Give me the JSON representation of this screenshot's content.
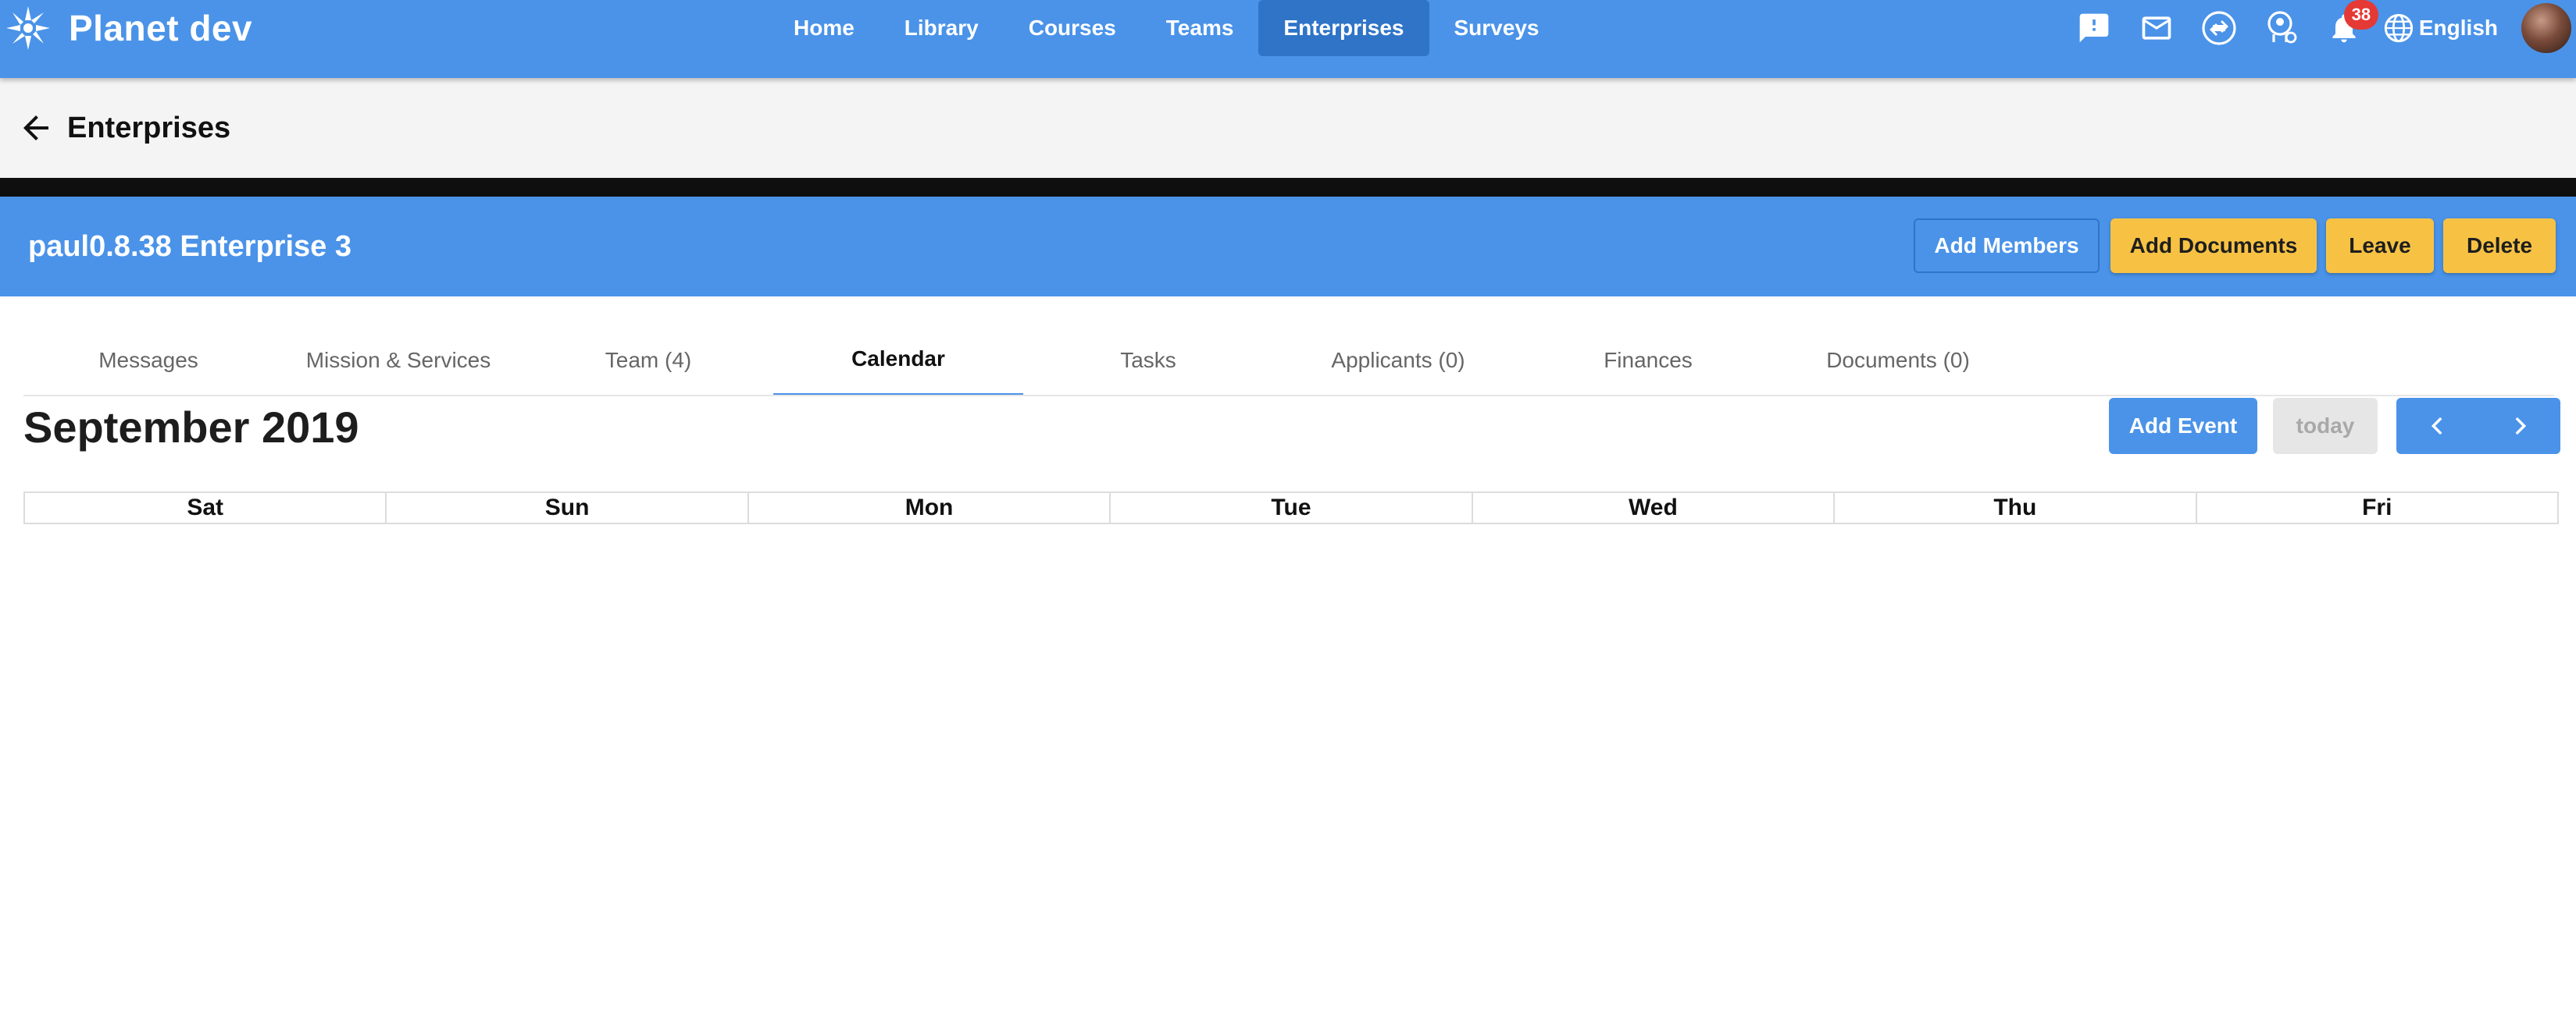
{
  "app": {
    "title": "Planet dev",
    "nav": [
      {
        "label": "Home",
        "active": false
      },
      {
        "label": "Library",
        "active": false
      },
      {
        "label": "Courses",
        "active": false
      },
      {
        "label": "Teams",
        "active": false
      },
      {
        "label": "Enterprises",
        "active": true
      },
      {
        "label": "Surveys",
        "active": false
      }
    ],
    "notifications_count": "38",
    "language": "English",
    "icons": [
      "feedback-icon",
      "mail-icon",
      "sync-icon",
      "user-settings-icon",
      "bell-icon",
      "globe-icon"
    ],
    "accent_color": "#4a93e8",
    "button_color": "#f7c244"
  },
  "page": {
    "title": "Enterprises"
  },
  "enterprise": {
    "name": "paul0.8.38 Enterprise 3",
    "actions": {
      "add_members": "Add Members",
      "add_documents": "Add Documents",
      "leave": "Leave",
      "delete": "Delete"
    }
  },
  "tabs": [
    {
      "label": "Messages",
      "active": false
    },
    {
      "label": "Mission & Services",
      "active": false
    },
    {
      "label": "Team (4)",
      "active": false
    },
    {
      "label": "Calendar",
      "active": true
    },
    {
      "label": "Tasks",
      "active": false
    },
    {
      "label": "Applicants (0)",
      "active": false
    },
    {
      "label": "Finances",
      "active": false
    },
    {
      "label": "Documents (0)",
      "active": false
    }
  ],
  "calendar": {
    "month_title": "September 2019",
    "add_event": "Add Event",
    "today": "today",
    "days": [
      "Sat",
      "Sun",
      "Mon",
      "Tue",
      "Wed",
      "Thu",
      "Fri"
    ]
  }
}
